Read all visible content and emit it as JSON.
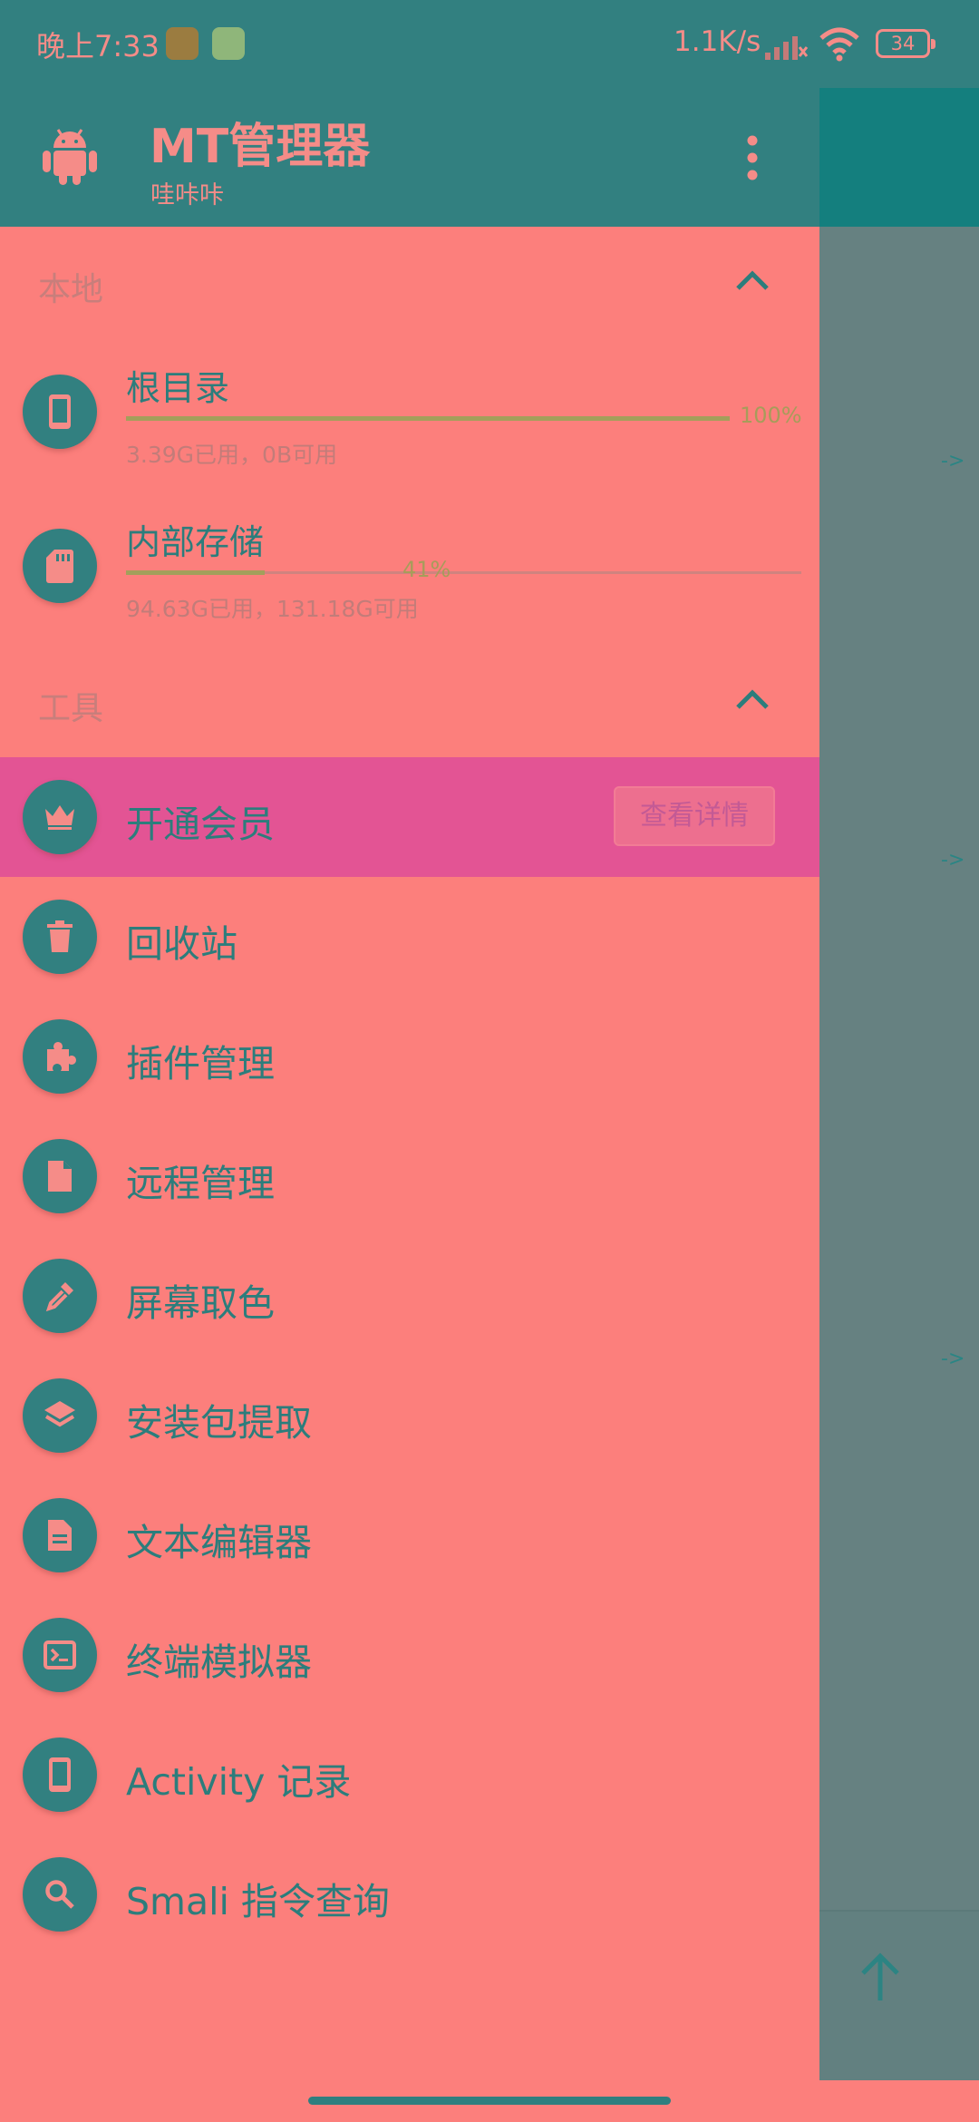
{
  "status_bar": {
    "time": "晚上7:33",
    "network_speed": "1.1K/s",
    "battery": "34"
  },
  "header": {
    "title": "MT管理器",
    "subtitle": "哇咔咔"
  },
  "sections": {
    "local": "本地",
    "tools": "工具"
  },
  "storage": [
    {
      "name": "根目录",
      "percent_label": "100%",
      "fraction": 1.0,
      "detail": "3.39G已用，0B可用",
      "icon": "phone-icon"
    },
    {
      "name": "内部存储",
      "percent_label": "41%",
      "fraction": 0.41,
      "detail": "94.63G已用，131.18G可用",
      "icon": "sd-card-icon"
    }
  ],
  "tools": [
    {
      "label": "开通会员",
      "icon": "crown-icon",
      "button": "查看详情"
    },
    {
      "label": "回收站",
      "icon": "trash-icon"
    },
    {
      "label": "插件管理",
      "icon": "puzzle-icon"
    },
    {
      "label": "远程管理",
      "icon": "file-icon"
    },
    {
      "label": "屏幕取色",
      "icon": "eyedropper-icon"
    },
    {
      "label": "安装包提取",
      "icon": "layers-icon"
    },
    {
      "label": "文本编辑器",
      "icon": "document-icon"
    },
    {
      "label": "终端模拟器",
      "icon": "terminal-icon"
    },
    {
      "label": "Activity 记录",
      "icon": "phone-icon"
    },
    {
      "label": "Smali 指令查询",
      "icon": "search-icon"
    }
  ],
  "main": {
    "arrow": "->"
  },
  "colors": {
    "primary": "#328080",
    "drawer_bg": "#fc7f7c",
    "highlight": "#e35494",
    "icon_glyph": "#f58c88"
  }
}
